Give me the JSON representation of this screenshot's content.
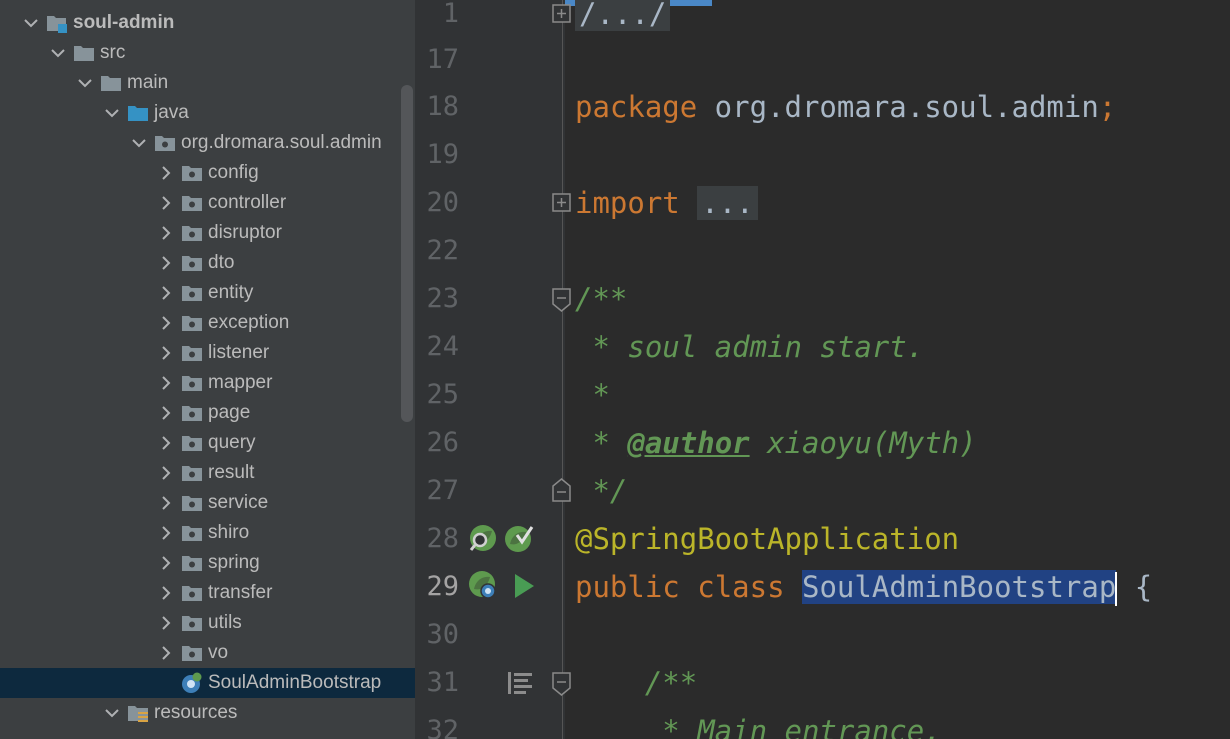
{
  "project_tree": {
    "items": [
      {
        "label": "soul-admin",
        "depth": 0,
        "expanded": true,
        "icon": "module-folder-icon",
        "bold": true
      },
      {
        "label": "src",
        "depth": 1,
        "expanded": true,
        "icon": "folder-icon"
      },
      {
        "label": "main",
        "depth": 2,
        "expanded": true,
        "icon": "folder-icon"
      },
      {
        "label": "java",
        "depth": 3,
        "expanded": true,
        "icon": "source-folder-icon"
      },
      {
        "label": "org.dromara.soul.admin",
        "depth": 4,
        "expanded": true,
        "icon": "package-icon"
      },
      {
        "label": "config",
        "depth": 5,
        "expanded": false,
        "icon": "package-icon"
      },
      {
        "label": "controller",
        "depth": 5,
        "expanded": false,
        "icon": "package-icon"
      },
      {
        "label": "disruptor",
        "depth": 5,
        "expanded": false,
        "icon": "package-icon"
      },
      {
        "label": "dto",
        "depth": 5,
        "expanded": false,
        "icon": "package-icon"
      },
      {
        "label": "entity",
        "depth": 5,
        "expanded": false,
        "icon": "package-icon"
      },
      {
        "label": "exception",
        "depth": 5,
        "expanded": false,
        "icon": "package-icon"
      },
      {
        "label": "listener",
        "depth": 5,
        "expanded": false,
        "icon": "package-icon"
      },
      {
        "label": "mapper",
        "depth": 5,
        "expanded": false,
        "icon": "package-icon"
      },
      {
        "label": "page",
        "depth": 5,
        "expanded": false,
        "icon": "package-icon"
      },
      {
        "label": "query",
        "depth": 5,
        "expanded": false,
        "icon": "package-icon"
      },
      {
        "label": "result",
        "depth": 5,
        "expanded": false,
        "icon": "package-icon"
      },
      {
        "label": "service",
        "depth": 5,
        "expanded": false,
        "icon": "package-icon"
      },
      {
        "label": "shiro",
        "depth": 5,
        "expanded": false,
        "icon": "package-icon"
      },
      {
        "label": "spring",
        "depth": 5,
        "expanded": false,
        "icon": "package-icon"
      },
      {
        "label": "transfer",
        "depth": 5,
        "expanded": false,
        "icon": "package-icon"
      },
      {
        "label": "utils",
        "depth": 5,
        "expanded": false,
        "icon": "package-icon"
      },
      {
        "label": "vo",
        "depth": 5,
        "expanded": false,
        "icon": "package-icon"
      },
      {
        "label": "SoulAdminBootstrap",
        "depth": 5,
        "leaf": true,
        "selected": true,
        "icon": "spring-boot-class-icon"
      },
      {
        "label": "resources",
        "depth": 3,
        "expanded": true,
        "icon": "resources-folder-icon"
      }
    ]
  },
  "editor": {
    "line_numbers": [
      "1",
      "17",
      "18",
      "19",
      "20",
      "22",
      "23",
      "24",
      "25",
      "26",
      "27",
      "28",
      "29",
      "30",
      "31",
      "32"
    ],
    "current_line": "29",
    "code": {
      "header_fold": "/.../",
      "package_kw": "package",
      "package_name": " org.dromara.soul.admin",
      "semicolon": ";",
      "import_kw": "import",
      "import_fold": "...",
      "doc_open": "/**",
      "doc_desc": " * soul admin start.",
      "doc_star": " *",
      "doc_author_prefix": " * ",
      "doc_author_tag": "@author",
      "doc_author_name": " xiaoyu(Myth)",
      "doc_close": " */",
      "annotation": "@SpringBootApplication",
      "public_kw": "public",
      "class_kw": "class",
      "class_name": "SoulAdminBootstrap",
      "brace": " {",
      "inner_doc_open": "    /**",
      "inner_doc_desc": "     * Main entrance."
    }
  },
  "colors": {
    "keyword": "#cc7832",
    "annotation": "#bbb529",
    "doc_comment": "#629755",
    "identifier": "#a9b7c6",
    "selection": "#214283"
  }
}
